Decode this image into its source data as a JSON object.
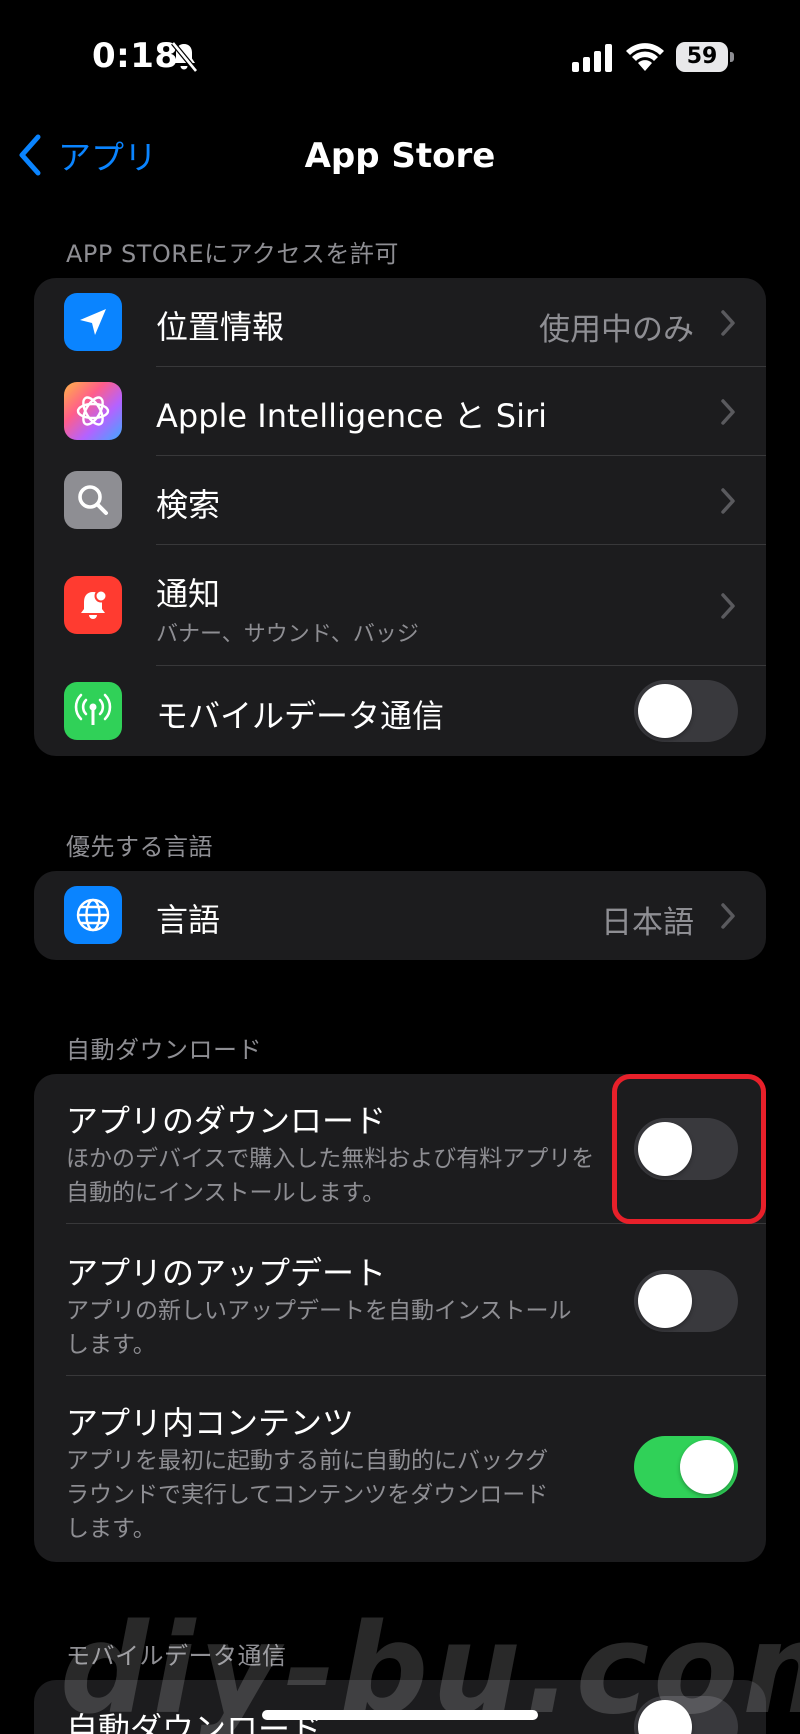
{
  "status_bar": {
    "time": "0:18",
    "battery": "59"
  },
  "nav": {
    "back_label": "アプリ",
    "title": "App Store"
  },
  "sections": {
    "access": {
      "header": "APP STOREにアクセスを許可",
      "location": {
        "label": "位置情報",
        "value": "使用中のみ",
        "icon": "location-arrow-icon",
        "color": "#0a84ff"
      },
      "siri": {
        "label": "Apple Intelligence と Siri",
        "icon": "apple-intelligence-icon"
      },
      "search": {
        "label": "検索",
        "icon": "magnifier-icon",
        "color": "#8e8e93"
      },
      "notifications": {
        "label": "通知",
        "sublabel": "バナー、サウンド、バッジ",
        "icon": "notification-bell-icon",
        "color": "#ff3b30"
      },
      "cellular": {
        "label": "モバイルデータ通信",
        "icon": "antenna-icon",
        "color": "#30d158",
        "enabled": false
      }
    },
    "language": {
      "header": "優先する言語",
      "language": {
        "label": "言語",
        "value": "日本語",
        "icon": "globe-icon",
        "color": "#0a84ff"
      }
    },
    "auto_download": {
      "header": "自動ダウンロード",
      "app_downloads": {
        "label": "アプリのダウンロード",
        "desc_line1": "ほかのデバイスで購入した無料および有料アプリを",
        "desc_line2": "自動的にインストールします。",
        "enabled": false
      },
      "app_updates": {
        "label": "アプリのアップデート",
        "desc_line1": "アプリの新しいアップデートを自動インストール",
        "desc_line2": "します。",
        "enabled": false
      },
      "in_app_content": {
        "label": "アプリ内コンテンツ",
        "desc_line1": "アプリを最初に起動する前に自動的にバックグ",
        "desc_line2": "ラウンドで実行してコンテンツをダウンロード",
        "desc_line3": "します。",
        "enabled": true
      }
    },
    "cellular_data": {
      "header": "モバイルデータ通信",
      "auto_downloads": {
        "label": "自動ダウンロード"
      }
    }
  },
  "watermark": "diy-bu.com",
  "colors": {
    "accent": "#0a84ff",
    "toggle_on": "#30d158",
    "highlight": "#e8202a"
  }
}
